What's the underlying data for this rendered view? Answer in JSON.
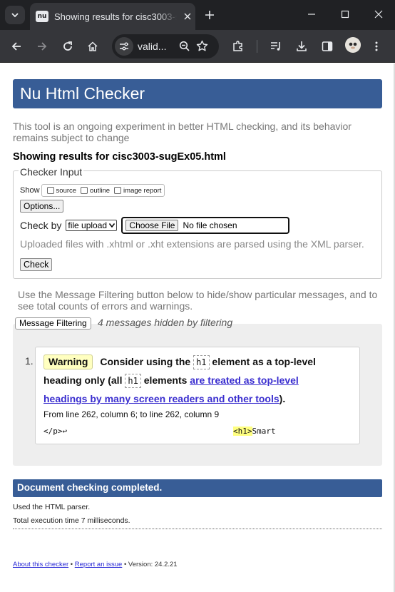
{
  "browser": {
    "tab": {
      "favicon_text": "nu",
      "title": "Showing results for cisc3003-sugEx05.html"
    },
    "omnibox": {
      "url_text": "valid..."
    }
  },
  "page": {
    "title": "Nu Html Checker",
    "intro": "This tool is an ongoing experiment in better HTML checking, and its behavior remains subject to change",
    "results_heading": "Showing results for cisc3003-sugEx05.html",
    "checker_input": {
      "legend": "Checker Input",
      "show_label": "Show",
      "show_options": [
        "source",
        "outline",
        "image report"
      ],
      "options_button": "Options...",
      "check_by_label": "Check by",
      "check_by_value": "file upload",
      "choose_file_button": "Choose File",
      "file_status": "No file chosen",
      "parse_note": "Uploaded files with .xhtml or .xht extensions are parsed using the XML parser.",
      "check_button": "Check"
    },
    "filter_note": "Use the Message Filtering button below to hide/show particular messages, and to see total counts of errors and warnings.",
    "filter_button": "Message Filtering",
    "hidden_note": "4 messages hidden by filtering",
    "messages": [
      {
        "number": "1.",
        "type": "Warning",
        "text_1": "Consider using the",
        "code_1": "h1",
        "text_2": "element as a top-level heading only (all",
        "code_2": "h1",
        "text_3": "elements",
        "link": "are treated as top-level headings by many screen readers and other tools",
        "text_4": ").",
        "location": "From line 262, column 6; to line 262, column 9",
        "extract_before": "</p>↩",
        "extract_highlight": "<h1>",
        "extract_after": "Smart"
      }
    ],
    "done": "Document checking completed.",
    "parser_note": "Used the HTML parser.",
    "exec_note": "Total execution time 7 milliseconds.",
    "footer": {
      "about_link": "About this checker",
      "sep": "•",
      "report_link": "Report an issue",
      "version": "• Version: 24.2.21"
    }
  }
}
